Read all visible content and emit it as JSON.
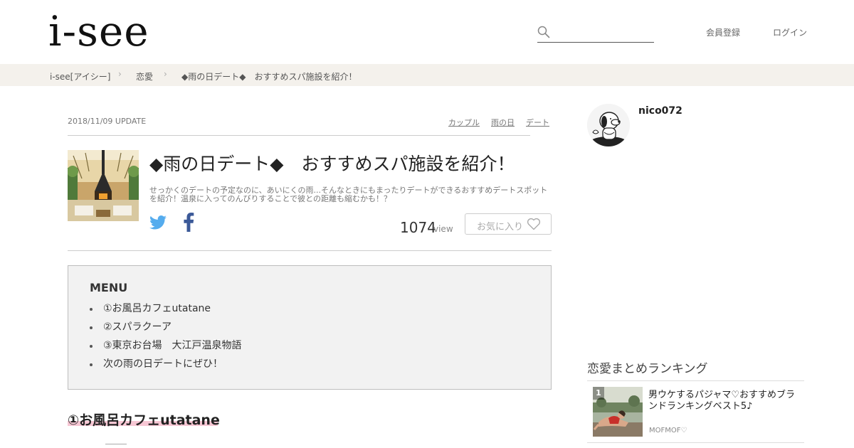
{
  "header": {
    "logo": "i-see",
    "search": {
      "placeholder": "",
      "value": ""
    },
    "register_label": "会員登録",
    "login_label": "ログイン"
  },
  "breadcrumb": {
    "items": [
      "i-see[アイシー]",
      "恋愛",
      "◆雨の日デート◆　おすすめスパ施設を紹介！"
    ],
    "separator": "›"
  },
  "article": {
    "date": "2018/11/09 UPDATE",
    "tags": [
      "カップル",
      "雨の日",
      "デート"
    ],
    "title": "◆雨の日デート◆　おすすめスパ施設を紹介！",
    "description": "せっかくのデートの予定なのに、あいにくの雨...そんなときにもまったりデートができるおすすめデートスポットを紹介！温泉に入ってのんびりすることで彼との距離も縮むかも！？",
    "views": "1074",
    "views_unit": "view",
    "favorite_label": "お気に入り",
    "share": {
      "twitter_icon": "twitter-icon",
      "facebook_icon": "facebook-icon"
    },
    "menu": {
      "title": "MENU",
      "items": [
        "①お風呂カフェutatane",
        "②スパラクーア",
        "③東京お台場　大江戸温泉物語",
        "次の雨の日デートにぜひ！"
      ]
    },
    "section_heading": "①お風呂カフェutatane"
  },
  "sidebar": {
    "author": "nico072",
    "ranking": {
      "title": "恋愛まとめランキング",
      "items": [
        {
          "rank": "1",
          "title": "男ウケするパジャマ♡おすすめブランドランキングベスト5♪",
          "author": "MOFMOF♡"
        }
      ]
    }
  },
  "colors": {
    "breadcrumb_bg": "#f4f1ec",
    "twitter": "#55acee",
    "facebook": "#3b5998",
    "heading_highlight": "#f7c7d4",
    "menu_bg": "#f2f2f2"
  }
}
